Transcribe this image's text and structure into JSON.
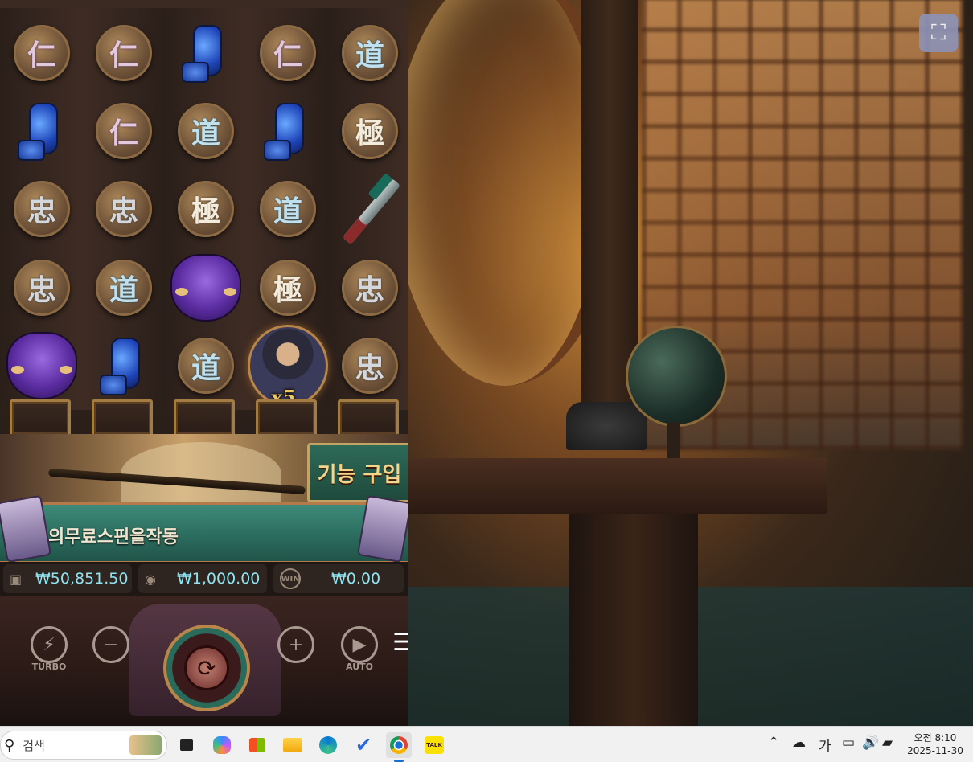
{
  "reels": {
    "rows": [
      [
        {
          "type": "coin",
          "kind": "ren",
          "glyph": "仁"
        },
        {
          "type": "coin",
          "kind": "ren",
          "glyph": "仁"
        },
        {
          "type": "bottle"
        },
        {
          "type": "coin",
          "kind": "ren",
          "glyph": "仁"
        },
        {
          "type": "coin",
          "kind": "dao",
          "glyph": "道"
        }
      ],
      [
        {
          "type": "bottle"
        },
        {
          "type": "coin",
          "kind": "ren",
          "glyph": "仁"
        },
        {
          "type": "coin",
          "kind": "dao",
          "glyph": "道"
        },
        {
          "type": "bottle"
        },
        {
          "type": "coin",
          "kind": "ji",
          "glyph": "極"
        }
      ],
      [
        {
          "type": "coin",
          "kind": "zhong",
          "glyph": "忠"
        },
        {
          "type": "coin",
          "kind": "zhong",
          "glyph": "忠"
        },
        {
          "type": "coin",
          "kind": "ji",
          "glyph": "極"
        },
        {
          "type": "coin",
          "kind": "dao",
          "glyph": "道"
        },
        {
          "type": "sword"
        }
      ],
      [
        {
          "type": "coin",
          "kind": "zhong",
          "glyph": "忠"
        },
        {
          "type": "coin",
          "kind": "dao",
          "glyph": "道"
        },
        {
          "type": "mask"
        },
        {
          "type": "coin",
          "kind": "ji",
          "glyph": "極"
        },
        {
          "type": "coin",
          "kind": "zhong",
          "glyph": "忠"
        }
      ],
      [
        {
          "type": "mask"
        },
        {
          "type": "bottle"
        },
        {
          "type": "coin",
          "kind": "dao",
          "glyph": "道"
        },
        {
          "type": "warrior",
          "multiplier": "x5"
        },
        {
          "type": "coin",
          "kind": "zhong",
          "glyph": "忠"
        }
      ]
    ]
  },
  "buy_feature_label": "기능 구입",
  "banner_text": "의무료스핀을작동",
  "info": {
    "balance": "₩50,851.50",
    "bet": "₩1,000.00",
    "win_icon": "WIN",
    "win": "₩0.00"
  },
  "controls": {
    "turbo_label": "TURBO",
    "auto_label": "AUTO",
    "minus": "−",
    "plus": "+",
    "menu": "☰"
  },
  "fullscreen_icon": "⛶",
  "taskbar": {
    "search_placeholder": "검색",
    "apps": [
      "task-view",
      "copilot",
      "store",
      "file-explorer",
      "edge",
      "todo",
      "chrome",
      "kakaotalk"
    ],
    "kakaotalk_label": "TALK",
    "ime": "가",
    "clock_time": "오전 8:10",
    "clock_date": "2025-11-30"
  },
  "colors": {
    "info_value": "#8fe4ef",
    "buy_button": "#2e6a58",
    "banner": "#3e8a7a"
  }
}
